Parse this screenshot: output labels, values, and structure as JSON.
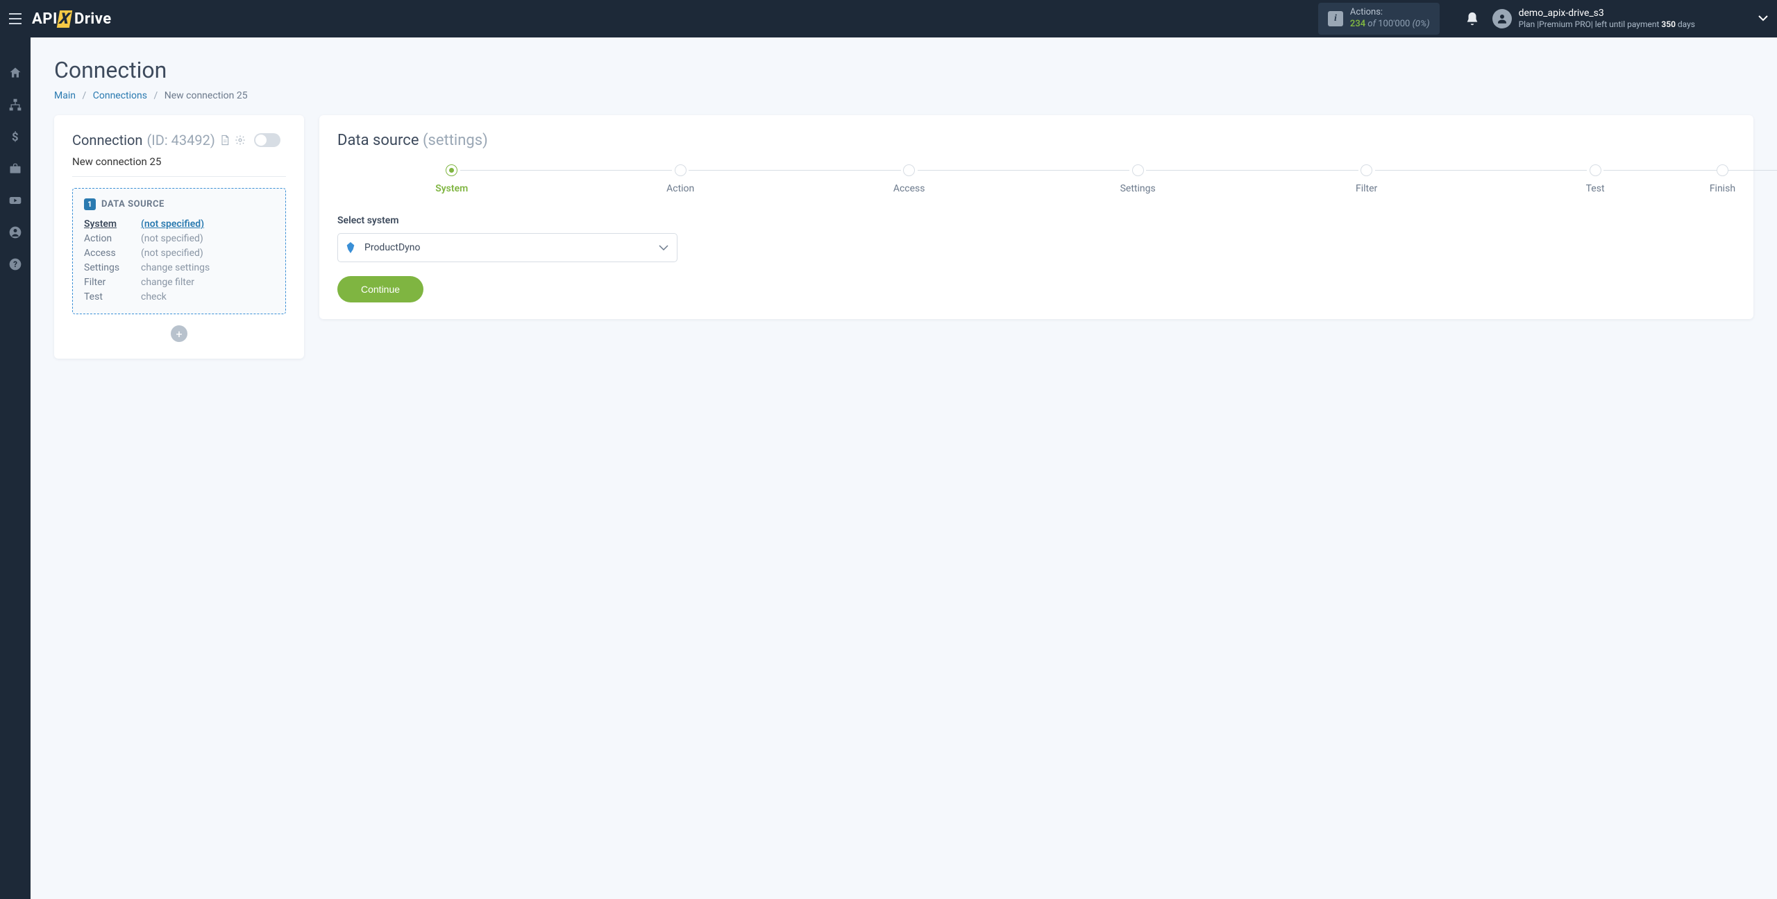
{
  "topbar": {
    "logo_api": "API",
    "logo_x": "X",
    "logo_drive": "Drive",
    "actions_label": "Actions:",
    "actions_count": "234",
    "actions_of": "of",
    "actions_total": "100'000",
    "actions_pct": "(0%)"
  },
  "user": {
    "name": "demo_apix-drive_s3",
    "plan_prefix": "Plan |",
    "plan_name": "Premium PRO",
    "plan_mid": "| left until payment ",
    "plan_days": "350",
    "plan_suffix": " days"
  },
  "page": {
    "title": "Connection"
  },
  "breadcrumb": {
    "main": "Main",
    "connections": "Connections",
    "current": "New connection 25"
  },
  "left": {
    "header": "Connection",
    "id_label": "(ID: 43492)",
    "name": "New connection 25",
    "ds_num": "1",
    "ds_title": "DATA SOURCE",
    "rows": [
      {
        "k": "System",
        "v": "(not specified)",
        "active": true
      },
      {
        "k": "Action",
        "v": "(not specified)"
      },
      {
        "k": "Access",
        "v": "(not specified)"
      },
      {
        "k": "Settings",
        "v": "change settings"
      },
      {
        "k": "Filter",
        "v": "change filter"
      },
      {
        "k": "Test",
        "v": "check"
      }
    ]
  },
  "right": {
    "header": "Data source",
    "header_sub": "(settings)",
    "steps": [
      "System",
      "Action",
      "Access",
      "Settings",
      "Filter",
      "Test",
      "Finish"
    ],
    "active_step": 0,
    "field_label": "Select system",
    "selected_system": "ProductDyno",
    "continue": "Continue"
  }
}
